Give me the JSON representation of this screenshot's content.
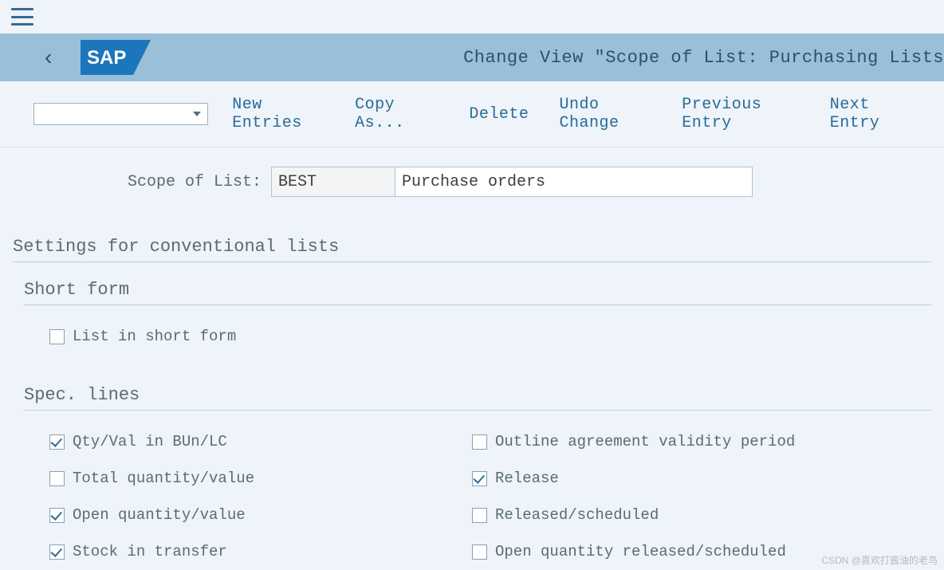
{
  "header": {
    "page_title": "Change View \"Scope of List: Purchasing Lists"
  },
  "toolbar": {
    "new_entries": "New Entries",
    "copy_as": "Copy As...",
    "delete": "Delete",
    "undo_change": "Undo Change",
    "previous_entry": "Previous Entry",
    "next_entry": "Next Entry"
  },
  "fields": {
    "scope_label": "Scope of List:",
    "scope_code": "BEST",
    "scope_desc": "Purchase orders"
  },
  "sections": {
    "settings_header": "Settings for conventional lists",
    "short_form_header": "Short form",
    "spec_lines_header": "Spec. lines"
  },
  "checkboxes": {
    "list_short_form": {
      "label": "List in short form",
      "checked": false
    },
    "qty_val_bun_lc": {
      "label": "Qty/Val in BUn/LC",
      "checked": true
    },
    "outline_agreement": {
      "label": "Outline agreement validity period",
      "checked": false
    },
    "total_qty_val": {
      "label": "Total quantity/value",
      "checked": false
    },
    "release": {
      "label": "Release",
      "checked": true
    },
    "open_qty_val": {
      "label": "Open quantity/value",
      "checked": true
    },
    "released_scheduled": {
      "label": "Released/scheduled",
      "checked": false
    },
    "stock_in_transfer": {
      "label": "Stock in transfer",
      "checked": true
    },
    "open_qty_rel_sched": {
      "label": "Open quantity released/scheduled",
      "checked": false
    }
  },
  "watermark": "CSDN @喜欢打酱油的老鸟"
}
